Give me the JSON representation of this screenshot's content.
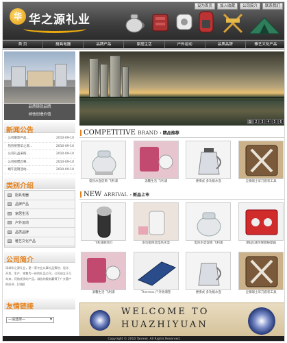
{
  "header": {
    "logo_char": "华",
    "logo_text": "华之源礼业",
    "top_links": [
      "设为首页",
      "加入收藏",
      "公司简介",
      "联系我们"
    ]
  },
  "nav": {
    "items": [
      "首 页",
      "厨具电器",
      "品牌产品",
      "家居生活",
      "户外运动",
      "品质品牌",
      "雅艺文化产品"
    ]
  },
  "left": {
    "building_caption": [
      "品质铸就品牌",
      "诚信创造价值"
    ],
    "news_title": "新闻公告",
    "news": [
      {
        "title": "公司最新产品…",
        "date": "2010-09-10"
      },
      {
        "title": "热烈祝贺华之源…",
        "date": "2010-09-10"
      },
      {
        "title": "公司礼品采购…",
        "date": "2010-09-10"
      },
      {
        "title": "公司招聘启事…",
        "date": "2010-09-10"
      },
      {
        "title": "端午促销活动…",
        "date": "2010-09-10"
      }
    ],
    "category_title": "类别介绍",
    "categories": [
      "厨具电器",
      "品牌产品",
      "家居生活",
      "户外运动",
      "品质品牌",
      "雅艺文化产品"
    ],
    "intro_title": "公司简介",
    "intro_text": "深圳华之源礼业，是一家专业从事礼品策划、设计、开发、生产、销售为一体的礼品公司，公司成立于几年来，凭借优质的产品，诚信的服务赢得了广大客户的好评…[详细]",
    "links_title": "友情链接",
    "links_select": "—请选择—"
  },
  "banner": {
    "pages": [
      "1",
      "2",
      "3",
      "4",
      "5",
      "6"
    ],
    "active_page": "1"
  },
  "competitive": {
    "en_title": "COMPETITIVE",
    "en_sub": "BRAND",
    "cn_title": "精品推荐",
    "products": [
      {
        "caption": "电热水壶促销 飞利浦"
      },
      {
        "caption": "温馨生活 飞利浦"
      },
      {
        "caption": "便携式 多功能水壶"
      },
      {
        "caption": "全钢瑞士军刀套装工具"
      }
    ]
  },
  "new_arrival": {
    "en_title": "NEW",
    "en_sub": "ARRIVAL",
    "cn_title": "新品上市",
    "products_row1": [
      {
        "caption": "飞利浦剃须刀"
      },
      {
        "caption": "多功能保温电热水壶"
      },
      {
        "caption": "电热水壶促销 飞利浦"
      },
      {
        "caption": "[精品]迷你保健按摩器"
      }
    ],
    "products_row2": [
      {
        "caption": "温馨生活 飞利浦"
      },
      {
        "caption": "Thermos 户外防潮垫"
      },
      {
        "caption": "便携式 多功能水壶"
      },
      {
        "caption": "全钢瑞士军刀套装工具"
      }
    ]
  },
  "welcome": {
    "line1": "WELCOME  TO",
    "line2": "HUAZHIYUAN"
  },
  "footer": {
    "copyright": "Copyright © 2010 Tanmei. All Rights Reserved."
  }
}
